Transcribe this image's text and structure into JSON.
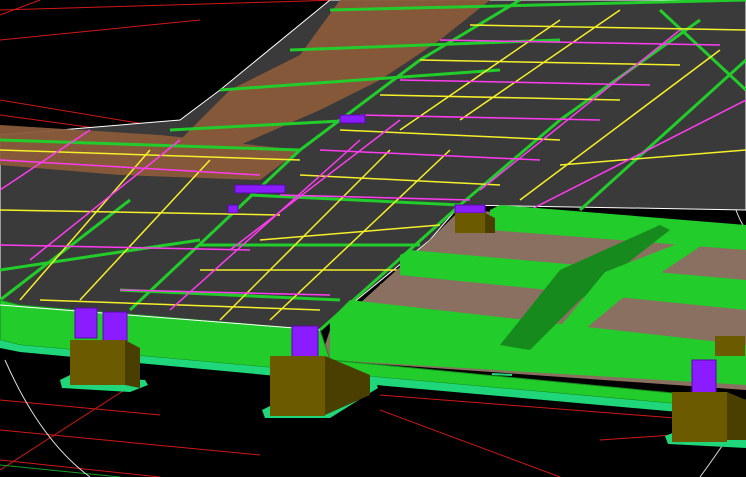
{
  "viewport": {
    "background_color": "#000000",
    "grid_color": "#d01818",
    "grid_color_secondary": "#1a9a2a",
    "slab_color": "#3a3a3a",
    "highlight_slab_color": "#8a5a3a",
    "beam_color": "#22cc2a",
    "beam_dark_color": "#168a1c",
    "yellow_line_color": "#f5f02a",
    "magenta_line_color": "#ff3cf0",
    "column_color": "#8a1cff",
    "footing_color": "#6b5a00",
    "footing_base_color": "#1fd67a",
    "edge_line_color": "#ffffff",
    "recessed_panel_color": "#8a7060",
    "guide_circle_color": "#dddddd"
  },
  "scene": {
    "label_text": ""
  }
}
